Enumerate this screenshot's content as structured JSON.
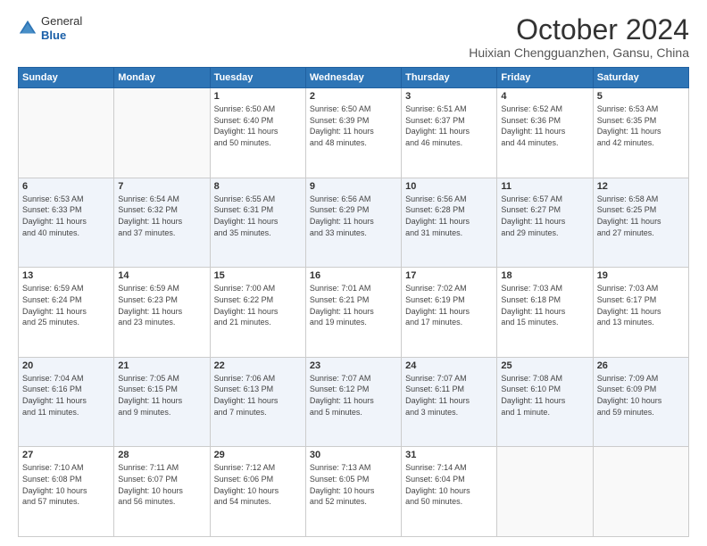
{
  "header": {
    "logo_line1": "General",
    "logo_line2": "Blue",
    "title": "October 2024",
    "location": "Huixian Chengguanzhen, Gansu, China"
  },
  "weekdays": [
    "Sunday",
    "Monday",
    "Tuesday",
    "Wednesday",
    "Thursday",
    "Friday",
    "Saturday"
  ],
  "weeks": [
    [
      {
        "day": "",
        "info": ""
      },
      {
        "day": "",
        "info": ""
      },
      {
        "day": "1",
        "info": "Sunrise: 6:50 AM\nSunset: 6:40 PM\nDaylight: 11 hours\nand 50 minutes."
      },
      {
        "day": "2",
        "info": "Sunrise: 6:50 AM\nSunset: 6:39 PM\nDaylight: 11 hours\nand 48 minutes."
      },
      {
        "day": "3",
        "info": "Sunrise: 6:51 AM\nSunset: 6:37 PM\nDaylight: 11 hours\nand 46 minutes."
      },
      {
        "day": "4",
        "info": "Sunrise: 6:52 AM\nSunset: 6:36 PM\nDaylight: 11 hours\nand 44 minutes."
      },
      {
        "day": "5",
        "info": "Sunrise: 6:53 AM\nSunset: 6:35 PM\nDaylight: 11 hours\nand 42 minutes."
      }
    ],
    [
      {
        "day": "6",
        "info": "Sunrise: 6:53 AM\nSunset: 6:33 PM\nDaylight: 11 hours\nand 40 minutes."
      },
      {
        "day": "7",
        "info": "Sunrise: 6:54 AM\nSunset: 6:32 PM\nDaylight: 11 hours\nand 37 minutes."
      },
      {
        "day": "8",
        "info": "Sunrise: 6:55 AM\nSunset: 6:31 PM\nDaylight: 11 hours\nand 35 minutes."
      },
      {
        "day": "9",
        "info": "Sunrise: 6:56 AM\nSunset: 6:29 PM\nDaylight: 11 hours\nand 33 minutes."
      },
      {
        "day": "10",
        "info": "Sunrise: 6:56 AM\nSunset: 6:28 PM\nDaylight: 11 hours\nand 31 minutes."
      },
      {
        "day": "11",
        "info": "Sunrise: 6:57 AM\nSunset: 6:27 PM\nDaylight: 11 hours\nand 29 minutes."
      },
      {
        "day": "12",
        "info": "Sunrise: 6:58 AM\nSunset: 6:25 PM\nDaylight: 11 hours\nand 27 minutes."
      }
    ],
    [
      {
        "day": "13",
        "info": "Sunrise: 6:59 AM\nSunset: 6:24 PM\nDaylight: 11 hours\nand 25 minutes."
      },
      {
        "day": "14",
        "info": "Sunrise: 6:59 AM\nSunset: 6:23 PM\nDaylight: 11 hours\nand 23 minutes."
      },
      {
        "day": "15",
        "info": "Sunrise: 7:00 AM\nSunset: 6:22 PM\nDaylight: 11 hours\nand 21 minutes."
      },
      {
        "day": "16",
        "info": "Sunrise: 7:01 AM\nSunset: 6:21 PM\nDaylight: 11 hours\nand 19 minutes."
      },
      {
        "day": "17",
        "info": "Sunrise: 7:02 AM\nSunset: 6:19 PM\nDaylight: 11 hours\nand 17 minutes."
      },
      {
        "day": "18",
        "info": "Sunrise: 7:03 AM\nSunset: 6:18 PM\nDaylight: 11 hours\nand 15 minutes."
      },
      {
        "day": "19",
        "info": "Sunrise: 7:03 AM\nSunset: 6:17 PM\nDaylight: 11 hours\nand 13 minutes."
      }
    ],
    [
      {
        "day": "20",
        "info": "Sunrise: 7:04 AM\nSunset: 6:16 PM\nDaylight: 11 hours\nand 11 minutes."
      },
      {
        "day": "21",
        "info": "Sunrise: 7:05 AM\nSunset: 6:15 PM\nDaylight: 11 hours\nand 9 minutes."
      },
      {
        "day": "22",
        "info": "Sunrise: 7:06 AM\nSunset: 6:13 PM\nDaylight: 11 hours\nand 7 minutes."
      },
      {
        "day": "23",
        "info": "Sunrise: 7:07 AM\nSunset: 6:12 PM\nDaylight: 11 hours\nand 5 minutes."
      },
      {
        "day": "24",
        "info": "Sunrise: 7:07 AM\nSunset: 6:11 PM\nDaylight: 11 hours\nand 3 minutes."
      },
      {
        "day": "25",
        "info": "Sunrise: 7:08 AM\nSunset: 6:10 PM\nDaylight: 11 hours\nand 1 minute."
      },
      {
        "day": "26",
        "info": "Sunrise: 7:09 AM\nSunset: 6:09 PM\nDaylight: 10 hours\nand 59 minutes."
      }
    ],
    [
      {
        "day": "27",
        "info": "Sunrise: 7:10 AM\nSunset: 6:08 PM\nDaylight: 10 hours\nand 57 minutes."
      },
      {
        "day": "28",
        "info": "Sunrise: 7:11 AM\nSunset: 6:07 PM\nDaylight: 10 hours\nand 56 minutes."
      },
      {
        "day": "29",
        "info": "Sunrise: 7:12 AM\nSunset: 6:06 PM\nDaylight: 10 hours\nand 54 minutes."
      },
      {
        "day": "30",
        "info": "Sunrise: 7:13 AM\nSunset: 6:05 PM\nDaylight: 10 hours\nand 52 minutes."
      },
      {
        "day": "31",
        "info": "Sunrise: 7:14 AM\nSunset: 6:04 PM\nDaylight: 10 hours\nand 50 minutes."
      },
      {
        "day": "",
        "info": ""
      },
      {
        "day": "",
        "info": ""
      }
    ]
  ]
}
